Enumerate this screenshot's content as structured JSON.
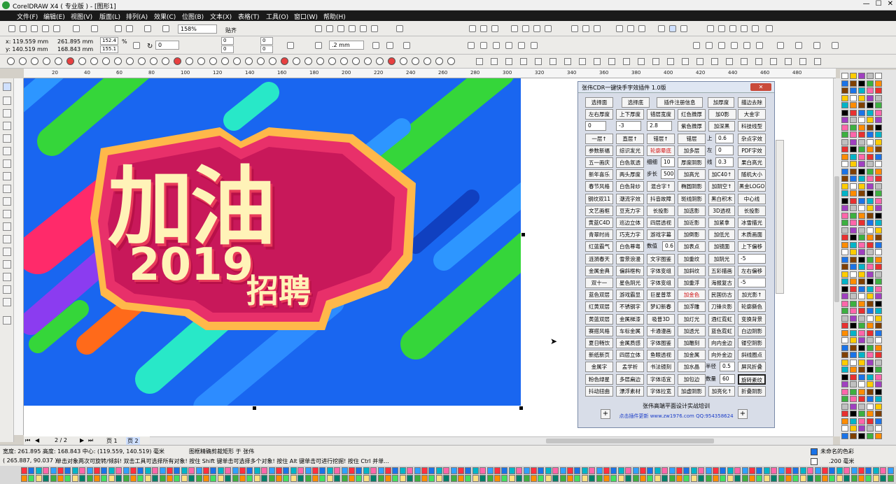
{
  "window": {
    "title": "CorelDRAW X4 ( 专业版 ) - [图形1]",
    "controls": [
      "—",
      "☐",
      "✕"
    ]
  },
  "menu": [
    "文件(F)",
    "编辑(E)",
    "视图(V)",
    "版面(L)",
    "排列(A)",
    "效果(C)",
    "位图(B)",
    "文本(X)",
    "表格(T)",
    "工具(O)",
    "窗口(W)",
    "帮助(H)"
  ],
  "toolbar": {
    "zoom": "158%",
    "snap": "贴齐",
    "x": "x: 119.559 mm",
    "y": "y: 140.519 mm",
    "w": "261.895 mm",
    "h": "168.843 mm",
    "sx": "152.4",
    "sy": "155.1",
    "pct": "%",
    "rotate": "0",
    "nudge0": "0",
    "nudge1": "0",
    "nudge2": "0",
    "nudge3": "0",
    "outline": ".2 mm"
  },
  "ruler_h": [
    "20",
    "40",
    "60",
    "80",
    "100",
    "120",
    "140",
    "160",
    "180",
    "200",
    "220",
    "240",
    "260",
    "280",
    "300",
    "320",
    "340",
    "360",
    "380",
    "400",
    "420",
    "440",
    "460",
    "480"
  ],
  "artwork": {
    "line1": "加油",
    "line2": "2019",
    "line3": "招聘"
  },
  "plugin": {
    "title": "张伟CDR一键快手字效插件 1.0版",
    "close": "✕",
    "footer": "张伟高端平面设计实战培训",
    "site": "点击插件更新 www.zw1976.com      QQ:954358624",
    "plus": "+",
    "r0": [
      "选择面",
      "选择底",
      "插件注册信息",
      "加厚度",
      "描边去除"
    ],
    "r1": [
      "左右厚度",
      "上下厚度",
      "错层宽度",
      "红色微厚",
      "加0影",
      "大金字"
    ],
    "r2f": [
      "0",
      "-3",
      "2.8"
    ],
    "r2": [
      "紫色微厚",
      "加深黑",
      "科技线型"
    ],
    "r3": [
      "一层↑",
      "直层↑",
      "错层↑",
      "错层",
      "上",
      "0.6",
      "杂点字效"
    ],
    "r4": [
      "参数新福",
      "综识发光",
      "轮廓晕底",
      "加多层",
      "左",
      "0",
      "PDF字效"
    ],
    "r5": [
      "五一画庆",
      "白色氛透",
      "细细",
      "10",
      "厚度阴影",
      "线",
      "0.3",
      "果白高光"
    ],
    "r6": [
      "新年喜乐",
      "两头厚度",
      "步长",
      "500",
      "加高光",
      "加C40↑",
      "随机大小"
    ],
    "r7": [
      "春节风格",
      "白色背纱",
      "混合字↑",
      "椭圆阴影",
      "加阴空↑",
      "黑金LOGO"
    ],
    "r8": [
      "钢纹双11",
      "潮流字效",
      "抖音故障",
      "斑线阴影",
      "黑白积木",
      "中心线"
    ],
    "r9": [
      "文艺画框",
      "豆克力字",
      "长投影",
      "加选影",
      "3D透视",
      "长投影"
    ],
    "r10": [
      "黄蓝C4D",
      "巡边立体",
      "四层透视",
      "加近影",
      "加紧拿",
      "冰雪描光"
    ],
    "r11": [
      "青翠时尚",
      "巧克力字",
      "游戏字幕",
      "加倒影",
      "加低光",
      "木质画面"
    ],
    "r12": [
      "红蓝霸气",
      "白色尊粤",
      "数值",
      "0.6",
      "加表点",
      "加镜面",
      "上下偏移"
    ],
    "r13": [
      "涟漪春天",
      "雪景浪漫",
      "文字图鉴",
      "加重纹",
      "加阴光",
      "-5"
    ],
    "r14": [
      "金属金典",
      "偏斜框构",
      "字体变组",
      "加斜纹",
      "五彩描画",
      "左右偏移"
    ],
    "r15": [
      "双十一",
      "星色阴光",
      "字体变组",
      "加重浮",
      "海报复古",
      "-5"
    ],
    "r16": [
      "蓝色双层",
      "游戏霸显",
      "巨星普萃",
      "加金色",
      "民国仿古",
      "加光影↑"
    ],
    "r17": [
      "红黄双层",
      "不锈钢字",
      "梦幻新春",
      "加浮雕",
      "刀锋炎影",
      "轮廓撕色"
    ],
    "r18": [
      "黄蓝双层",
      "金属梯漆",
      "吸普3D",
      "加灯光",
      "酒红霓虹",
      "变换背景"
    ],
    "r19": [
      "赛搭风格",
      "车标金属",
      "卡通漫画",
      "加透光",
      "蓝色霓虹",
      "白边阴影"
    ],
    "r20": [
      "夏日畅饮",
      "金属质感",
      "字体图鉴",
      "加雕刻",
      "向内金边",
      "镂空阴影"
    ],
    "r21": [
      "新纸新页",
      "四层立体",
      "鱼眼透视",
      "加金属",
      "向外金边",
      "斜线圈点"
    ],
    "r22": [
      "金属字",
      "孟学析",
      "书法镜刻",
      "加水晶",
      "半径",
      "0.5",
      "屏风折叠"
    ],
    "r23": [
      "粉色绿星",
      "多层扁边",
      "字体适宜",
      "加包边",
      "数量",
      "60",
      "旋转紊纹"
    ],
    "r24": [
      "抖动扭曲",
      "漂浮素材",
      "字体拉宽",
      "加虚阴影",
      "加亮化↑",
      "折叠阴影"
    ]
  },
  "pagenav": {
    "page": "2 / 2",
    "tab1": "页 1",
    "tab2": "页 2"
  },
  "status": {
    "line1": "宽度: 261.895  高度: 168.843  中心: (119.559, 140.519)  毫米",
    "line1b": "图框精确剪裁矩形 于 张伟",
    "line2": "( 265.887, 90.037 )",
    "line2b": "单击对象两次可旋转/倾斜! 双击工具可选择所有对象! 按住 Shift 键单击可选择多个对象! 按住 Alt 键单击可进行挖掘! 按住 Ctrl 并单...",
    "fill": "未命名的色彩",
    "outline": ".200 毫米"
  },
  "colors": {
    "menubar": "#1a1a1a",
    "artboard": "#1966f0",
    "plugin_bg": "#d8dde8"
  }
}
